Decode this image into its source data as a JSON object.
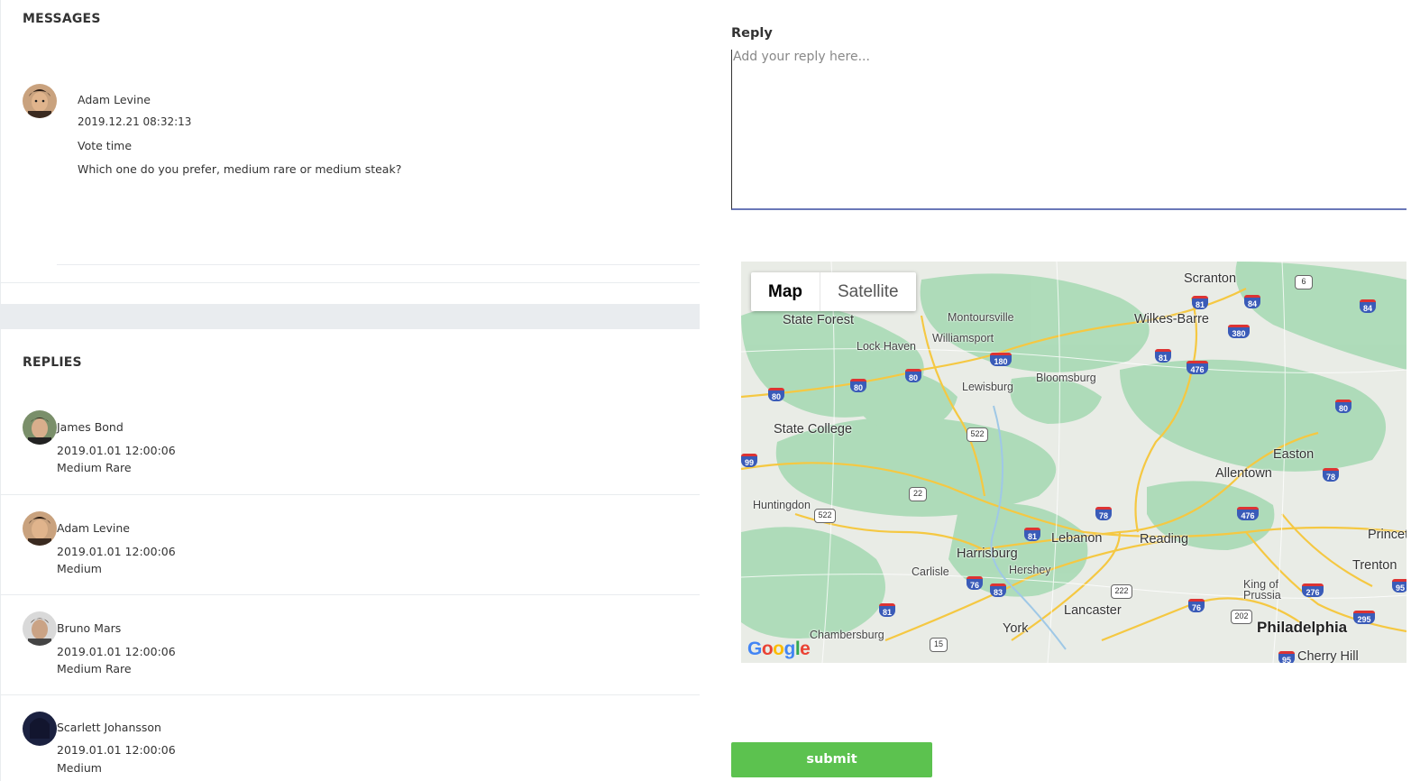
{
  "messages": {
    "title": "MESSAGES",
    "author": "Adam Levine",
    "date": "2019.12.21 08:32:13",
    "subject": "Vote time",
    "body": "Which one do you prefer, medium rare or medium steak?"
  },
  "replies": {
    "title": "REPLIES",
    "items": [
      {
        "name": "James Bond",
        "date": "2019.01.01 12:00:06",
        "text": "Medium Rare"
      },
      {
        "name": "Adam Levine",
        "date": "2019.01.01 12:00:06",
        "text": "Medium"
      },
      {
        "name": "Bruno Mars",
        "date": "2019.01.01 12:00:06",
        "text": "Medium Rare"
      },
      {
        "name": "Scarlett Johansson",
        "date": "2019.01.01 12:00:06",
        "text": "Medium"
      }
    ]
  },
  "reply_form": {
    "label": "Reply",
    "placeholder": "Add your reply here...",
    "submit_label": "submit"
  },
  "map": {
    "tabs": [
      "Map",
      "Satellite"
    ],
    "active_tab": "Map",
    "cities": [
      "State Forest",
      "Montoursville",
      "Williamsport",
      "Lock Haven",
      "Scranton",
      "Wilkes-Barre",
      "Bloomsburg",
      "Lewisburg",
      "State College",
      "Easton",
      "Allentown",
      "Huntingdon",
      "Lebanon",
      "Reading",
      "Harrisburg",
      "Hershey",
      "Carlisle",
      "Princet",
      "Trenton",
      "King of Prussia",
      "Lancaster",
      "York",
      "Chambersburg",
      "Philadelphia",
      "Cherry Hill"
    ],
    "interstates": [
      "81",
      "84",
      "80",
      "380",
      "180",
      "476",
      "78",
      "76",
      "83",
      "276",
      "295",
      "95"
    ],
    "us_routes": [
      "6",
      "522",
      "22",
      "222",
      "202",
      "15"
    ],
    "provider": "Google"
  }
}
